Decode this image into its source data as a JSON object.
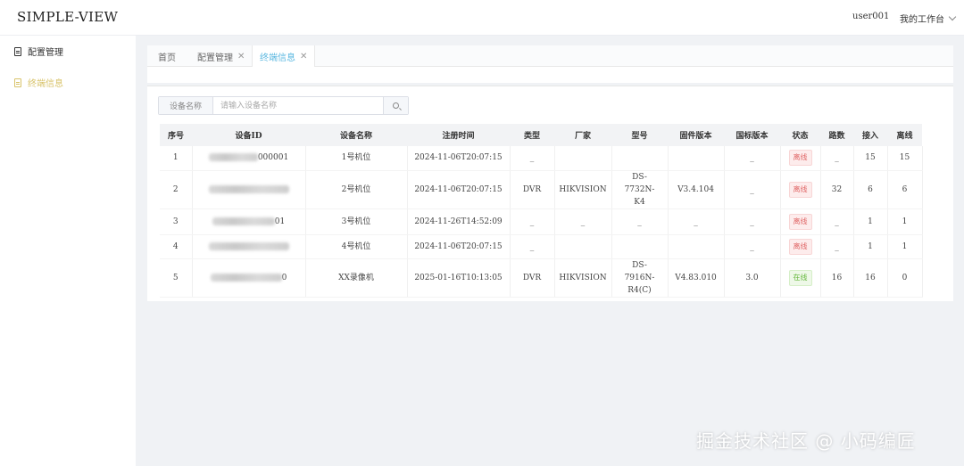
{
  "app": {
    "title": "SIMPLE-VIEW",
    "user": "user001",
    "workspace": "我的工作台"
  },
  "sidebar": {
    "items": [
      {
        "label": "配置管理"
      },
      {
        "label": "终端信息"
      }
    ]
  },
  "tabs": [
    {
      "label": "首页"
    },
    {
      "label": "配置管理"
    },
    {
      "label": "终端信息"
    }
  ],
  "search": {
    "label": "设备名称",
    "placeholder": "请输入设备名称"
  },
  "table": {
    "columns": [
      "序号",
      "设备ID",
      "设备名称",
      "注册时间",
      "类型",
      "厂家",
      "型号",
      "固件版本",
      "国标版本",
      "状态",
      "路数",
      "接入",
      "离线"
    ],
    "rows": [
      {
        "no": "1",
        "id": "000001",
        "name": "1号机位",
        "time": "2024-11-06T20:07:15",
        "type": "_",
        "vendor": "",
        "model": "",
        "fw": "",
        "gb": "_",
        "status": "离线",
        "paths": "_",
        "access": "15",
        "offline": "15"
      },
      {
        "no": "2",
        "id": "",
        "name": "2号机位",
        "time": "2024-11-06T20:07:15",
        "type": "DVR",
        "vendor": "HIKVISION",
        "model": "DS-7732N-K4",
        "fw": "V3.4.104",
        "gb": "_",
        "status": "离线",
        "paths": "32",
        "access": "6",
        "offline": "6"
      },
      {
        "no": "3",
        "id": "01",
        "name": "3号机位",
        "time": "2024-11-26T14:52:09",
        "type": "_",
        "vendor": "_",
        "model": "_",
        "fw": "_",
        "gb": "_",
        "status": "离线",
        "paths": "_",
        "access": "1",
        "offline": "1"
      },
      {
        "no": "4",
        "id": "",
        "name": "4号机位",
        "time": "2024-11-06T20:07:15",
        "type": "_",
        "vendor": "",
        "model": "",
        "fw": "",
        "gb": "_",
        "status": "离线",
        "paths": "_",
        "access": "1",
        "offline": "1"
      },
      {
        "no": "5",
        "id": "0",
        "name": "XX录像机",
        "time": "2025-01-16T10:13:05",
        "type": "DVR",
        "vendor": "HIKVISION",
        "model": "DS-7916N-R4(C)",
        "fw": "V4.83.010",
        "gb": "3.0",
        "status": "在线",
        "paths": "16",
        "access": "16",
        "offline": "0"
      }
    ]
  },
  "watermark": "掘金技术社区 @ 小码编匠",
  "colors": {
    "accent": "#5cb8e0",
    "active_menu": "#d8c36a",
    "offline": "#e06666",
    "online": "#67b83f"
  }
}
